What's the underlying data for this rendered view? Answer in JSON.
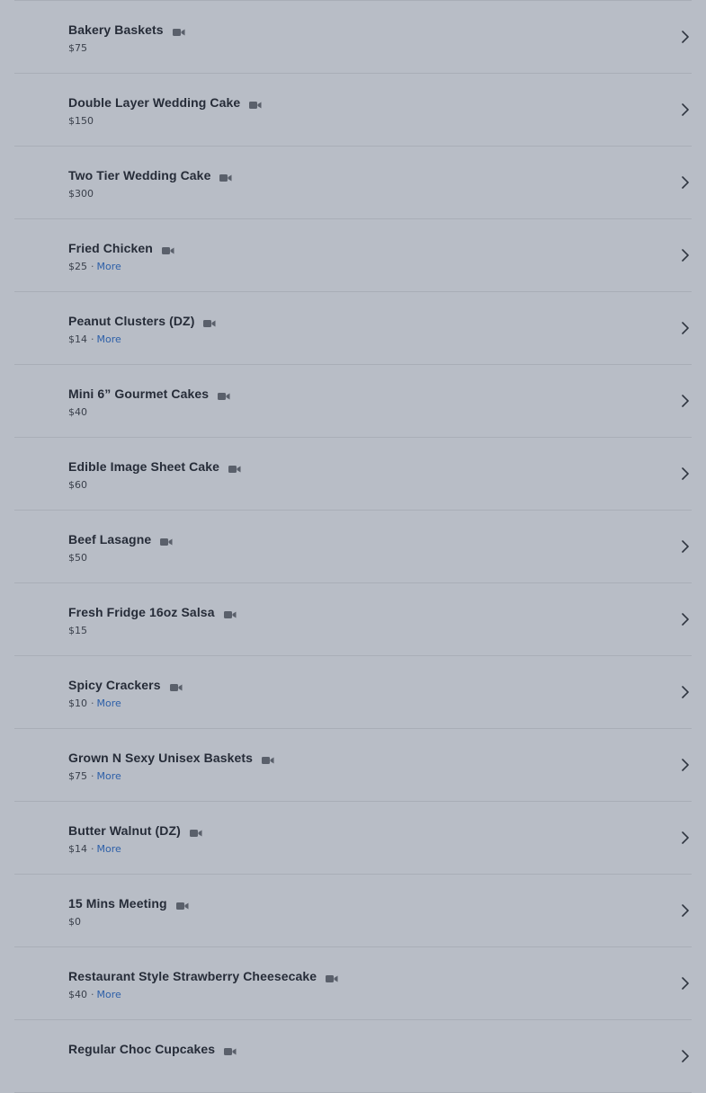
{
  "items": [
    {
      "title": "Bakery Baskets",
      "price": "$75",
      "more": null
    },
    {
      "title": "Double Layer Wedding Cake",
      "price": "$150",
      "more": null
    },
    {
      "title": "Two Tier Wedding Cake",
      "price": "$300",
      "more": null
    },
    {
      "title": "Fried Chicken",
      "price": "$25",
      "more": "More"
    },
    {
      "title": "Peanut Clusters (DZ)",
      "price": "$14",
      "more": "More"
    },
    {
      "title": "Mini 6” Gourmet Cakes",
      "price": "$40",
      "more": null
    },
    {
      "title": "Edible Image Sheet Cake",
      "price": "$60",
      "more": null
    },
    {
      "title": "Beef Lasagne",
      "price": "$50",
      "more": null
    },
    {
      "title": "Fresh Fridge 16oz Salsa",
      "price": "$15",
      "more": null
    },
    {
      "title": "Spicy Crackers",
      "price": "$10",
      "more": "More"
    },
    {
      "title": "Grown N Sexy Unisex Baskets",
      "price": "$75",
      "more": "More"
    },
    {
      "title": "Butter Walnut (DZ)",
      "price": "$14",
      "more": "More"
    },
    {
      "title": "15 Mins Meeting",
      "price": "$0",
      "more": null
    },
    {
      "title": "Restaurant Style Strawberry Cheesecake",
      "price": "$40",
      "more": "More"
    },
    {
      "title": "Regular Choc Cupcakes",
      "price": "",
      "more": null
    }
  ],
  "separator": "·",
  "icons": {
    "row_badge": "video-camera-icon",
    "row_action": "chevron-right-icon"
  },
  "colors": {
    "background": "#b8bdc6",
    "divider": "#a9aeb7",
    "title": "#262c38",
    "price": "#3a404b",
    "link": "#2c5fa8",
    "icon": "#5a606b"
  }
}
